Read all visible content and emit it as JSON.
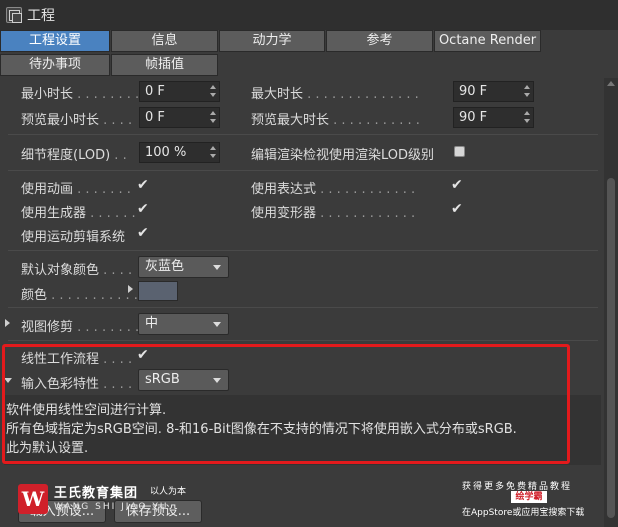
{
  "window": {
    "title": "工程"
  },
  "tabs": {
    "row1": [
      "工程设置",
      "信息",
      "动力学",
      "参考",
      "Octane Render"
    ],
    "row2": [
      "待办事项",
      "帧插值"
    ]
  },
  "settings": {
    "min_time": {
      "label": "最小时长",
      "dots": " . . . . . . . .",
      "value": "0 F"
    },
    "max_time": {
      "label": "最大时长",
      "dots": " . . . . . . . . . . . . . .",
      "value": "90 F"
    },
    "preview_min_time": {
      "label": "预览最小时长",
      "dots": " . . . .",
      "value": "0 F"
    },
    "preview_max_time": {
      "label": "预览最大时长",
      "dots": " . . . . . . . . . . .",
      "value": "90 F"
    },
    "lod": {
      "label": "细节程度(LOD)",
      "dots": " . .",
      "value": "100 %"
    },
    "editor_render_lod": {
      "label": "编辑渲染检视使用渲染LOD级别"
    },
    "use_animation": {
      "label": "使用动画",
      "dots": " . . . . . . .",
      "check": "✔"
    },
    "use_expressions": {
      "label": "使用表达式",
      "dots": " . . . . . . . . . . . .",
      "check": "✔"
    },
    "use_generators": {
      "label": "使用生成器",
      "dots": " . . . . . .",
      "check": "✔"
    },
    "use_deformers": {
      "label": "使用变形器",
      "dots": " . . . . . . . . . . . .",
      "check": "✔"
    },
    "use_motion_clip": {
      "label": "使用运动剪辑系统",
      "check": "✔"
    },
    "default_object_color": {
      "label": "默认对象颜色",
      "dots": " . . . .",
      "value": "灰蓝色"
    },
    "color": {
      "label": "颜色",
      "dots": " . . . . . . . . . . . ."
    },
    "view_clipping": {
      "label": "视图修剪",
      "dots": " . . . . . . . . .",
      "value": "中"
    },
    "linear_workflow": {
      "label": "线性工作流程",
      "dots": " . . . .",
      "check": "✔"
    },
    "input_color_profile": {
      "label": "输入色彩特性",
      "dots": " . . . .",
      "value": "sRGB"
    }
  },
  "description": [
    "软件使用线性空间进行计算.",
    "所有色域指定为sRGB空间. 8-和16-Bit图像在不支持的情况下将使用嵌入式分布或sRGB.",
    "此为默认设置."
  ],
  "buttons": {
    "load_preset": "载入预设...",
    "save_preset": "保存预设..."
  },
  "watermark": {
    "logo_letter": "W",
    "company": "王氏教育集团",
    "slogan": "以人为本",
    "sub": "WANG SHI JIAO YU",
    "right_line1": "获得更多免费精品教程",
    "right_badge": "绘学霸",
    "right_line3": "在AppStore或应用宝搜索下载"
  },
  "colors": {
    "active_tab": "#4a82c0",
    "highlight_box": "#e31a1c",
    "swatch": "#5a6270"
  }
}
